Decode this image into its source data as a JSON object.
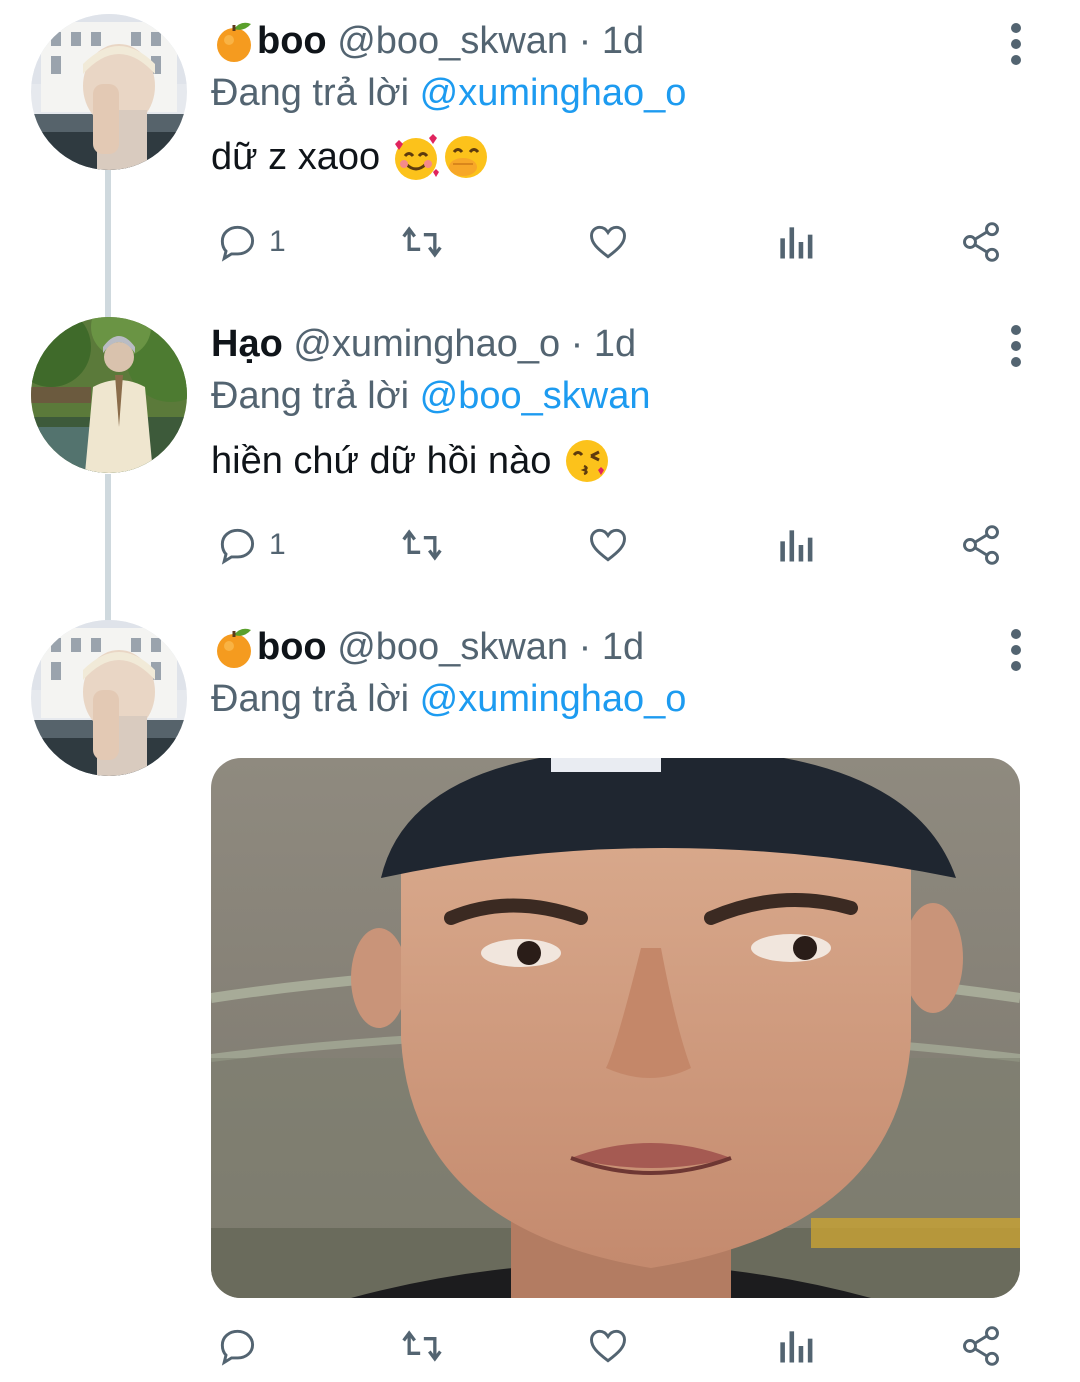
{
  "colors": {
    "text_primary": "#0f1419",
    "text_secondary": "#536471",
    "link": "#1d9bf0",
    "thread_line": "#cfd9de"
  },
  "tweets": [
    {
      "display_name": "boo",
      "name_emoji": "tangerine-emoji",
      "handle": "@boo_skwan",
      "separator": "·",
      "time": "1d",
      "reply_prefix": "Đang trả lời",
      "reply_to": "@xuminghao_o",
      "text": "dữ z xaoo",
      "text_emojis": [
        "smiling-face-with-hearts-emoji",
        "face-with-hand-over-mouth-emoji"
      ],
      "reply_count": "1",
      "has_media": false
    },
    {
      "display_name": "Hạo",
      "handle": "@xuminghao_o",
      "separator": "·",
      "time": "1d",
      "reply_prefix": "Đang trả lời",
      "reply_to": "@boo_skwan",
      "text": "hiền chứ dữ hồi nào",
      "text_emojis": [
        "face-blowing-kiss-emoji"
      ],
      "reply_count": "1",
      "has_media": false
    },
    {
      "display_name": "boo",
      "name_emoji": "tangerine-emoji",
      "handle": "@boo_skwan",
      "separator": "·",
      "time": "1d",
      "reply_prefix": "Đang trả lời",
      "reply_to": "@xuminghao_o",
      "text": "",
      "reply_count": "",
      "has_media": true,
      "media_description": "photo"
    }
  ],
  "icons": {
    "reply": "reply-icon",
    "retweet": "retweet-icon",
    "like": "heart-icon",
    "analytics": "analytics-icon",
    "share": "share-icon",
    "more": "more-vertical-icon"
  }
}
